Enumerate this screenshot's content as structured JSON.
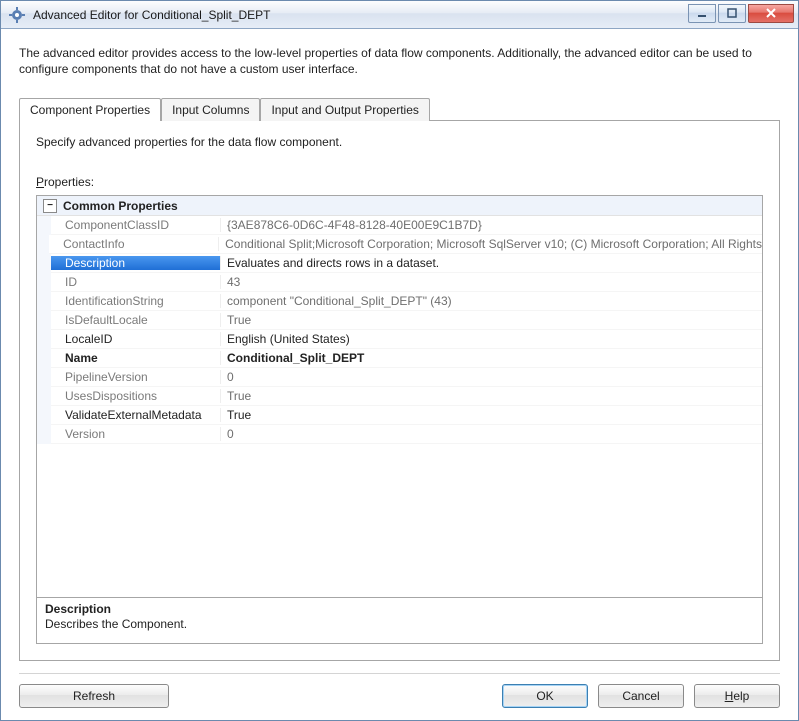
{
  "window": {
    "title": "Advanced Editor for Conditional_Split_DEPT"
  },
  "intro": "The advanced editor provides access to the low-level properties of data flow components. Additionally, the advanced editor can be used to configure components that do not have a custom user interface.",
  "tabs": [
    {
      "label": "Component Properties",
      "active": true
    },
    {
      "label": "Input Columns",
      "active": false
    },
    {
      "label": "Input and Output Properties",
      "active": false
    }
  ],
  "panel": {
    "description": "Specify advanced properties for the data flow component.",
    "properties_label_pre": "P",
    "properties_label_post": "roperties:"
  },
  "grid": {
    "category": "Common Properties",
    "rows": [
      {
        "key": "ComponentClassID",
        "val": "{3AE878C6-0D6C-4F48-8128-40E00E9C1B7D}",
        "style": "readonly"
      },
      {
        "key": "ContactInfo",
        "val": "Conditional Split;Microsoft Corporation; Microsoft SqlServer v10; (C) Microsoft Corporation; All Rights",
        "style": "readonly"
      },
      {
        "key": "Description",
        "val": "Evaluates and directs rows in a dataset.",
        "style": "selected"
      },
      {
        "key": "ID",
        "val": "43",
        "style": "readonly"
      },
      {
        "key": "IdentificationString",
        "val": "component \"Conditional_Split_DEPT\" (43)",
        "style": "readonly"
      },
      {
        "key": "IsDefaultLocale",
        "val": "True",
        "style": "readonly"
      },
      {
        "key": "LocaleID",
        "val": "English (United States)",
        "style": "editable"
      },
      {
        "key": "Name",
        "val": "Conditional_Split_DEPT",
        "style": "bold"
      },
      {
        "key": "PipelineVersion",
        "val": "0",
        "style": "readonly"
      },
      {
        "key": "UsesDispositions",
        "val": "True",
        "style": "readonly"
      },
      {
        "key": "ValidateExternalMetadata",
        "val": "True",
        "style": "editable"
      },
      {
        "key": "Version",
        "val": "0",
        "style": "readonly"
      }
    ]
  },
  "help_pane": {
    "title": "Description",
    "text": "Describes the Component."
  },
  "buttons": {
    "refresh": "Refresh",
    "ok": "OK",
    "cancel": "Cancel",
    "help_ul": "H",
    "help_rest": "elp"
  }
}
